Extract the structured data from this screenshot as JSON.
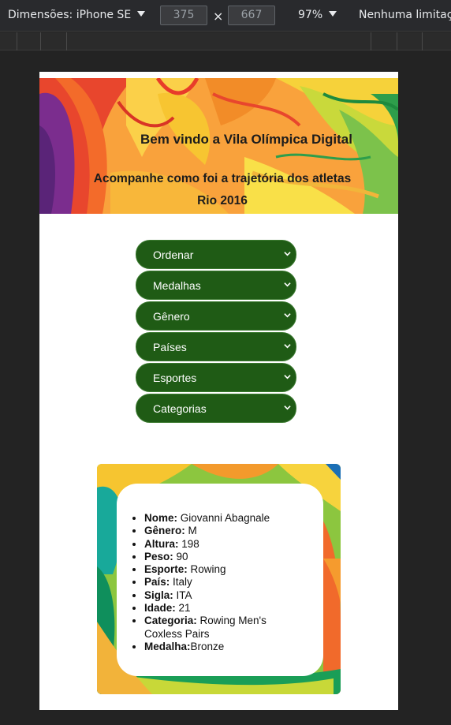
{
  "devtools": {
    "dimensions_label": "Dimensões: iPhone SE",
    "width_value": "375",
    "height_value": "667",
    "times": "×",
    "zoom": "97%",
    "throttle": "Nenhuma limitação"
  },
  "banner": {
    "title": "Bem vindo a Vila Olímpica Digital",
    "subtitle": "Acompanhe como foi a trajetória dos atletas Rio 2016"
  },
  "filters": [
    {
      "label": "Ordenar"
    },
    {
      "label": "Medalhas"
    },
    {
      "label": "Gênero"
    },
    {
      "label": "Países"
    },
    {
      "label": "Esportes"
    },
    {
      "label": "Categorias"
    }
  ],
  "athlete": {
    "name_label": "Nome:",
    "name": " Giovanni Abagnale",
    "gender_label": "Gênero:",
    "gender": " M",
    "height_label": "Altura:",
    "height": " 198",
    "weight_label": "Peso:",
    "weight": " 90",
    "sport_label": "Esporte:",
    "sport": " Rowing",
    "country_label": "País:",
    "country": " Italy",
    "code_label": "Sigla:",
    "code": " ITA",
    "age_label": "Idade:",
    "age": " 21",
    "category_label": "Categoria:",
    "category": " Rowing Men's Coxless Pairs",
    "medal_label": "Medalha:",
    "medal": "Bronze"
  },
  "colors": {
    "filter_bg": "#1f5b15",
    "device_bg": "#ffffff",
    "toolbar_bg": "#292a2d"
  }
}
